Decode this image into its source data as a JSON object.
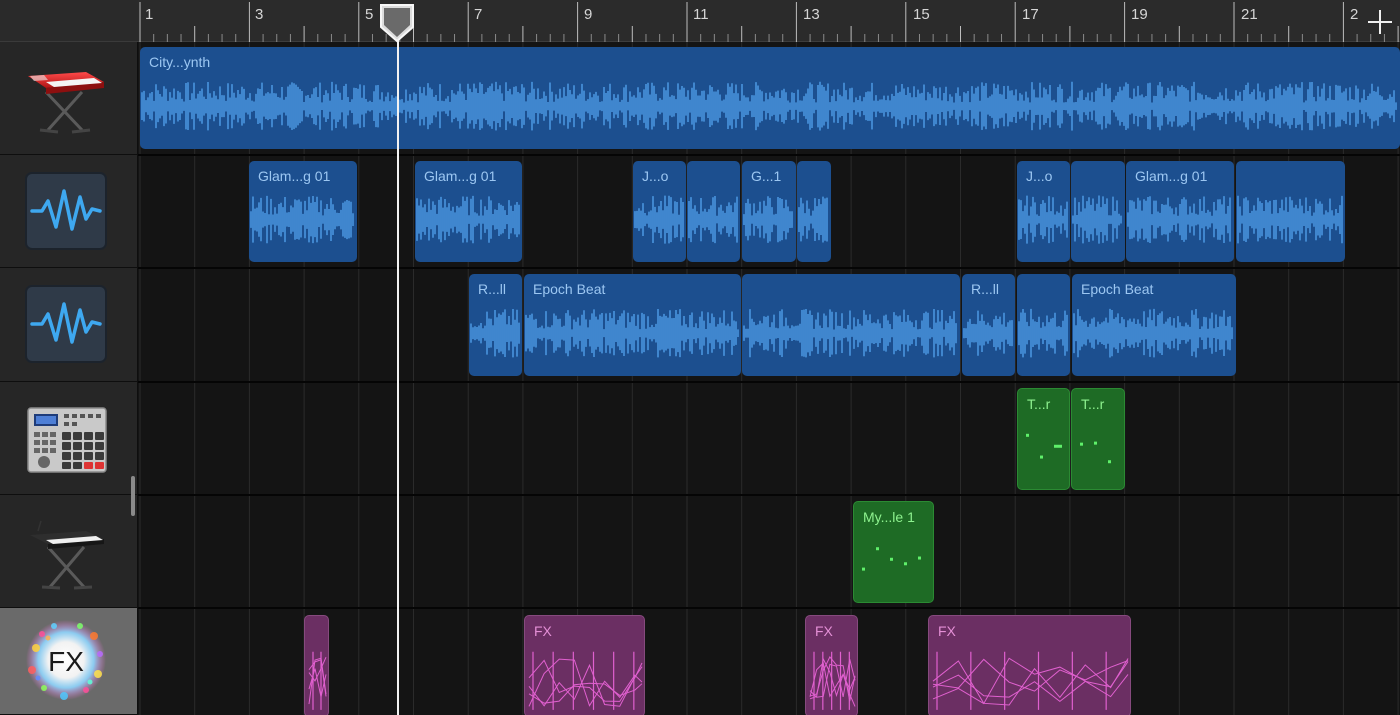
{
  "ruler": {
    "bar_numbers": [
      "1",
      "3",
      "5",
      "7",
      "9",
      "11",
      "13",
      "15",
      "17",
      "19",
      "21",
      "2"
    ]
  },
  "colors": {
    "audio_region": "#1c4f8f",
    "audio_wave": "#4f9ee8",
    "midi_region": "#1e6b25",
    "midi_note": "#5ff06a",
    "fx_region": "#6b2f63",
    "fx_line": "#e060cf",
    "playhead": "#f2f2f2"
  },
  "tracks": [
    {
      "icon": "keyboard-synth-icon",
      "kind": "audio",
      "regions": [
        {
          "label": "City...ynth"
        }
      ]
    },
    {
      "icon": "waveform-icon",
      "kind": "audio",
      "regions": [
        {
          "label": "Glam...g 01"
        },
        {
          "label": "Glam...g 01"
        },
        {
          "label": "J...o"
        },
        {
          "label": ""
        },
        {
          "label": "G...1"
        },
        {
          "label": ""
        },
        {
          "label": "J...o"
        },
        {
          "label": ""
        },
        {
          "label": "Glam...g 01"
        },
        {
          "label": ""
        }
      ]
    },
    {
      "icon": "waveform-icon",
      "kind": "audio",
      "regions": [
        {
          "label": "R...ll"
        },
        {
          "label": "Epoch Beat"
        },
        {
          "label": ""
        },
        {
          "label": "R...ll"
        },
        {
          "label": ""
        },
        {
          "label": "Epoch Beat"
        }
      ]
    },
    {
      "icon": "drum-machine-icon",
      "kind": "midi",
      "regions": [
        {
          "label": "T...r"
        },
        {
          "label": "T...r"
        }
      ]
    },
    {
      "icon": "keyboard-stand-icon",
      "kind": "midi",
      "regions": [
        {
          "label": "My...le 1"
        }
      ]
    },
    {
      "icon": "fx-icon",
      "icon_text": "FX",
      "kind": "fx",
      "regions": [
        {
          "label": ""
        },
        {
          "label": "FX"
        },
        {
          "label": "FX"
        },
        {
          "label": "FX"
        }
      ]
    }
  ]
}
